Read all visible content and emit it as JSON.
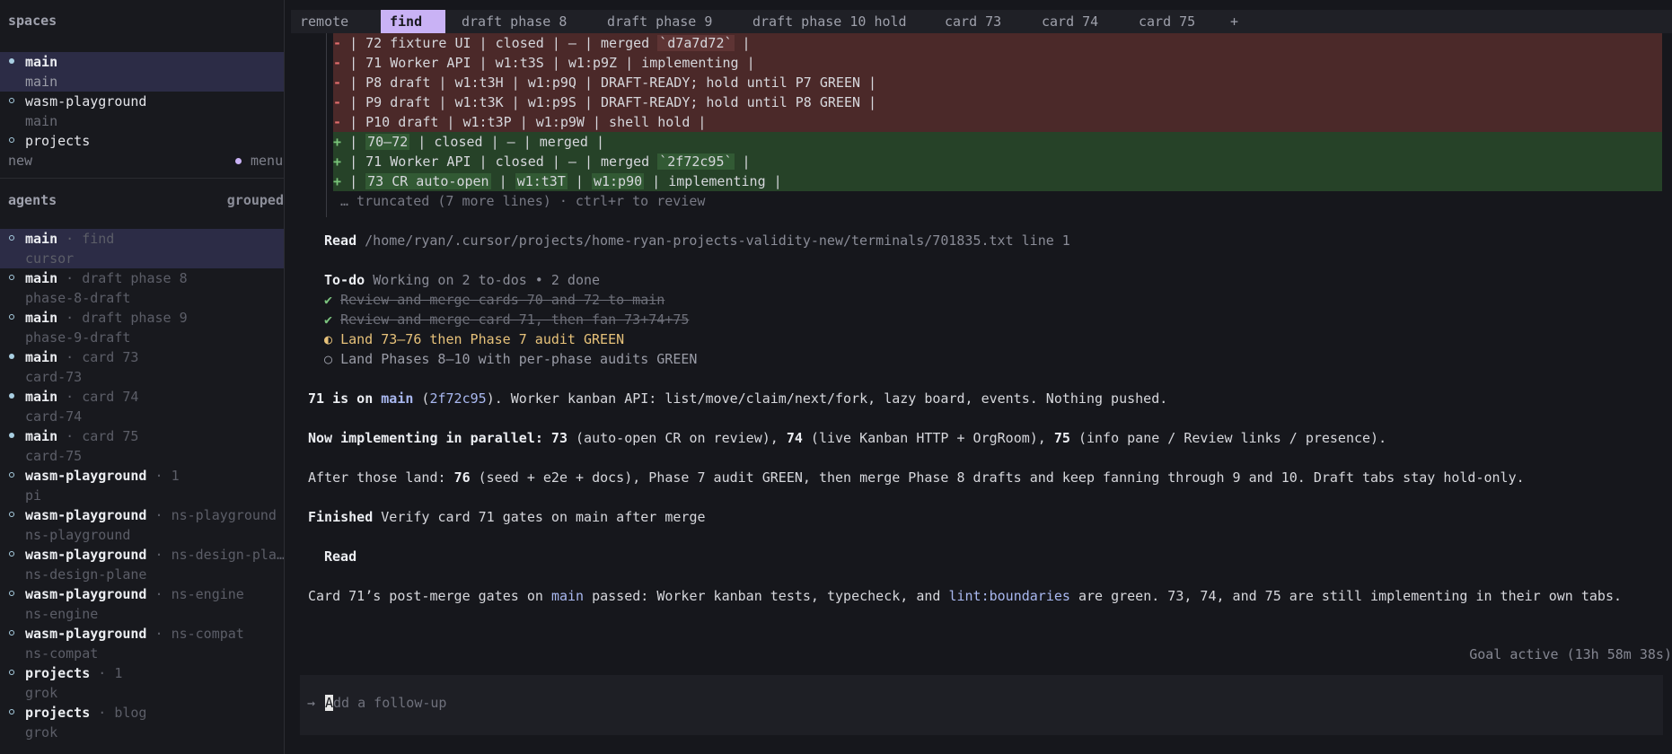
{
  "sidebar": {
    "spaces_title": "spaces",
    "spaces": [
      {
        "name": "main",
        "sub": "main",
        "dot": "filled",
        "selected": true
      },
      {
        "name": "wasm-playground",
        "sub": "main",
        "dot": "hollow",
        "selected": false
      },
      {
        "name": "projects",
        "sub": "",
        "dot": "hollow",
        "selected": false
      }
    ],
    "new_label": "new",
    "menu_label": "menu",
    "agents_title": "agents",
    "grouped_label": "grouped",
    "agents": [
      {
        "name": "main",
        "tag": "find",
        "sub": "cursor",
        "dot": "hollow",
        "selected": true
      },
      {
        "name": "main",
        "tag": "draft phase 8",
        "sub": "phase-8-draft",
        "dot": "hollow",
        "selected": false
      },
      {
        "name": "main",
        "tag": "draft phase 9",
        "sub": "phase-9-draft",
        "dot": "hollow",
        "selected": false
      },
      {
        "name": "main",
        "tag": "card 73",
        "sub": "card-73",
        "dot": "filled",
        "selected": false
      },
      {
        "name": "main",
        "tag": "card 74",
        "sub": "card-74",
        "dot": "filled",
        "selected": false
      },
      {
        "name": "main",
        "tag": "card 75",
        "sub": "card-75",
        "dot": "filled",
        "selected": false
      },
      {
        "name": "wasm-playground",
        "tag": "1",
        "sub": "pi",
        "dot": "hollow",
        "selected": false
      },
      {
        "name": "wasm-playground",
        "tag": "ns-playground",
        "sub": "ns-playground",
        "dot": "hollow",
        "selected": false
      },
      {
        "name": "wasm-playground",
        "tag": "ns-design-pla…",
        "sub": "ns-design-plane",
        "dot": "hollow",
        "selected": false
      },
      {
        "name": "wasm-playground",
        "tag": "ns-engine",
        "sub": "ns-engine",
        "dot": "hollow",
        "selected": false
      },
      {
        "name": "wasm-playground",
        "tag": "ns-compat",
        "sub": "ns-compat",
        "dot": "hollow",
        "selected": false
      },
      {
        "name": "projects",
        "tag": "1",
        "sub": "grok",
        "dot": "hollow",
        "selected": false
      },
      {
        "name": "projects",
        "tag": "blog",
        "sub": "grok",
        "dot": "hollow",
        "selected": false
      }
    ]
  },
  "tabs": [
    {
      "label": "remote",
      "active": false
    },
    {
      "label": "find",
      "active": true
    },
    {
      "label": "draft phase 8",
      "active": false
    },
    {
      "label": "draft phase 9",
      "active": false
    },
    {
      "label": "draft phase 10 hold",
      "active": false
    },
    {
      "label": "card 73",
      "active": false
    },
    {
      "label": "card 74",
      "active": false
    },
    {
      "label": "card 75",
      "active": false
    },
    {
      "label": "+",
      "active": false
    }
  ],
  "diff": {
    "removed": [
      {
        "pre": "| 72 fixture UI | closed | — | merged ",
        "code": "`d7a7d72`",
        "post": " |"
      },
      {
        "pre": "| 71 Worker API | w1:t3S | w1:p9Z | implementing |",
        "code": "",
        "post": ""
      },
      {
        "pre": "| P8 draft | w1:t3H | w1:p9Q | DRAFT-READY; hold until P7 GREEN |",
        "code": "",
        "post": ""
      },
      {
        "pre": "| P9 draft | w1:t3K | w1:p9S | DRAFT-READY; hold until P8 GREEN |",
        "code": "",
        "post": ""
      },
      {
        "pre": "| P10 draft | w1:t3P | w1:p9W | shell hold |",
        "code": "",
        "post": ""
      }
    ],
    "added": [
      {
        "pre": "| ",
        "code": "70–72",
        "post": " | closed | — | merged |"
      },
      {
        "pre": "| 71 Worker API | closed | — | merged ",
        "code": "`2f72c95`",
        "post": " |"
      },
      {
        "pre": "| ",
        "code": "73 CR auto-open",
        "post": " | ",
        "code2": "w1:t3T",
        "post2": " | ",
        "code3": "w1:p90",
        "post3": " | implementing |"
      }
    ],
    "truncated": "… truncated (7 more lines) · ctrl+r to review"
  },
  "read_line": {
    "label": "Read",
    "path": "/home/ryan/.cursor/projects/home-ryan-projects-validity-new/terminals/701835.txt line 1"
  },
  "todo": {
    "label": "To-do",
    "summary": "Working on 2 to-dos • 2 done",
    "items": [
      {
        "mark": "✔",
        "text": "Review and merge cards 70 and 72 to main",
        "state": "done"
      },
      {
        "mark": "✔",
        "text": "Review and merge card 71, then fan 73+74+75",
        "state": "done"
      },
      {
        "mark": "◐",
        "text": "Land 73–76 then Phase 7 audit GREEN",
        "state": "active"
      },
      {
        "mark": "○",
        "text": "Land Phases 8–10 with per-phase audits GREEN",
        "state": "pending"
      }
    ]
  },
  "messages": {
    "m1": {
      "a": "71 is on ",
      "b": "main",
      "c": " (",
      "d": "2f72c95",
      "e": "). Worker kanban API: list/move/claim/next/fork, lazy board, events. Nothing pushed."
    },
    "m2": {
      "a": "Now implementing in parallel: 73",
      "b": " (auto-open CR on review), ",
      "c": "74",
      "d": " (live Kanban HTTP + OrgRoom), ",
      "e": "75",
      "f": " (info pane / Review links / presence)."
    },
    "m3": {
      "a": "After those land: ",
      "b": "76",
      "c": " (seed + e2e + docs), Phase 7 audit GREEN, then merge Phase 8 drafts and keep fanning through 9 and 10. Draft tabs stay hold-only."
    },
    "m4": {
      "a": "Finished",
      "b": " Verify card 71 gates on main after merge"
    },
    "m5": {
      "a": "Read"
    },
    "m6": {
      "a": "Card 71’s post-merge gates on ",
      "b": "main",
      "c": " passed: Worker kanban tests, typecheck, and ",
      "d": "lint:boundaries",
      "e": " are green. 73, 74, and 75 are still implementing in their own tabs."
    }
  },
  "goal_status": "Goal active (13h 58m 38s)",
  "input": {
    "prompt": "→",
    "cursor_char": "A",
    "placeholder_rest": "dd a follow-up"
  }
}
